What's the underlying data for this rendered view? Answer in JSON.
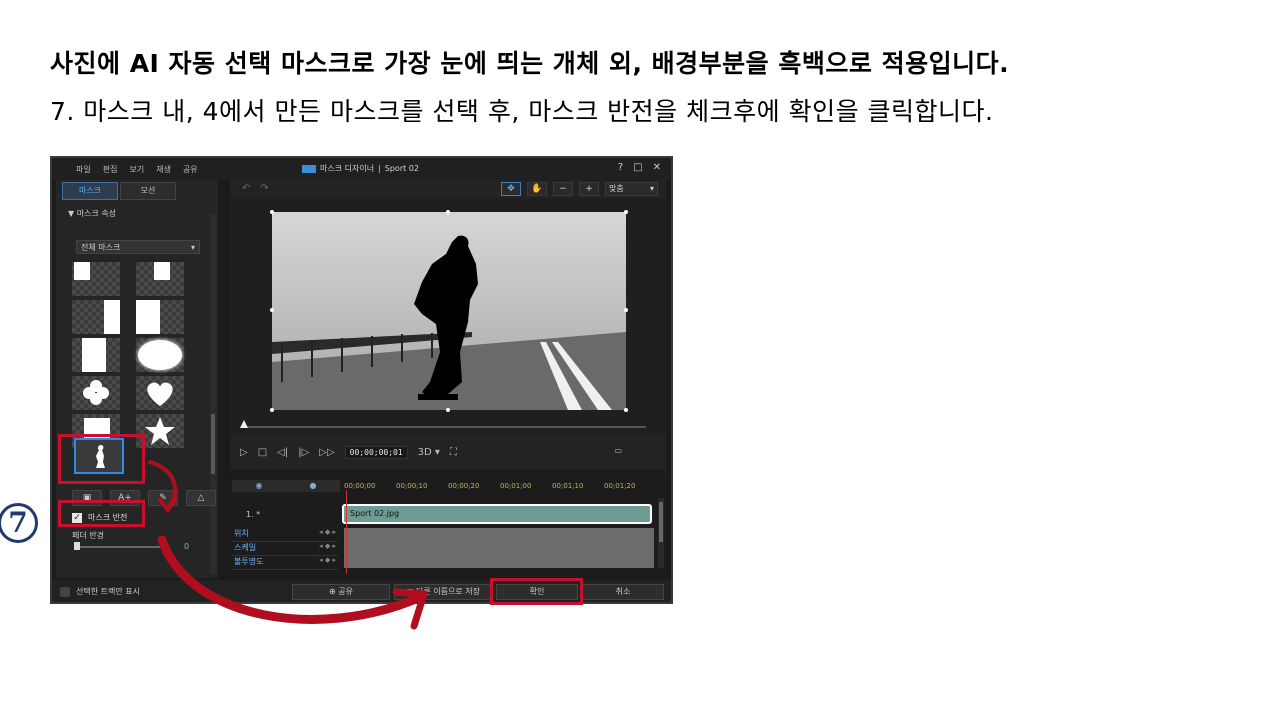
{
  "instructions": {
    "line1": "사진에 AI 자동 선택 마스크로 가장 눈에 띄는 개체 외, 배경부분을 흑백으로 적용입니다.",
    "line2": "7. 마스크 내, 4에서 만든 마스크를 선택 후, 마스크 반전을 체크후에 확인을 클릭합니다."
  },
  "step_badge": "7",
  "app": {
    "menu": [
      "파일",
      "편집",
      "보기",
      "재생",
      "공유"
    ],
    "window_title": "마스크 디자이너",
    "project_name": "Sport 02",
    "window_controls": [
      "?",
      "□",
      "✕"
    ],
    "tabs": [
      "마스크",
      "모션"
    ],
    "active_tab": "마스크",
    "section_title": "▼ 마스크 속성",
    "mask_dropdown": "전체 마스크",
    "invert_mask_label": "마스크 반전",
    "invert_mask_checked": true,
    "feather_label": "페더 반경",
    "feather_value": "0",
    "only_selected_track": "선택한 트랙만 표시",
    "fit_label": "맞춤",
    "timecode": "00;00;00;01",
    "view_3d": "3D ▾",
    "ruler": [
      "00;00;00",
      "00;00;10",
      "00;00;20",
      "00;01;00",
      "00;01;10",
      "00;01;20"
    ],
    "track_name": "1. *",
    "clip_name": "Sport 02.jpg",
    "track_rows": [
      "위치",
      "스케일",
      "불투명도"
    ],
    "buttons": {
      "share": "공유",
      "save_as": "다른 이름으로 저장",
      "ok": "확인",
      "cancel": "취소"
    }
  },
  "colors": {
    "highlight": "#c8102e",
    "accent": "#2f8ae8",
    "badge": "#1f3a6b"
  }
}
